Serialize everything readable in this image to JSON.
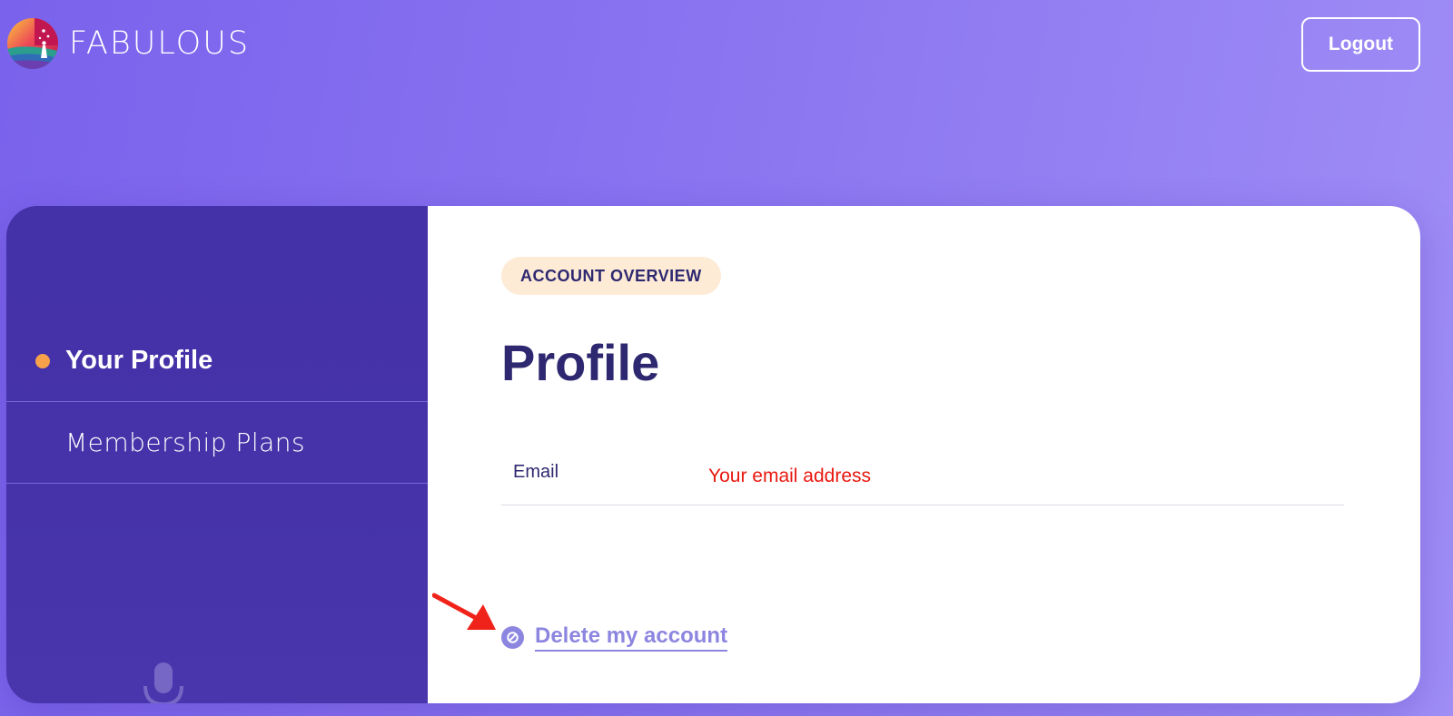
{
  "header": {
    "brand_name": "FABULOUS",
    "logout_label": "Logout"
  },
  "sidebar": {
    "items": [
      {
        "label": "Your Profile",
        "active": true
      },
      {
        "label": "Membership Plans",
        "active": false
      }
    ]
  },
  "main": {
    "badge": "ACCOUNT OVERVIEW",
    "title": "Profile",
    "fields": [
      {
        "label": "Email",
        "value": "Your email address"
      }
    ],
    "delete_label": "Delete my account"
  },
  "colors": {
    "background_start": "#7a62ec",
    "sidebar": "#4432a8",
    "active_dot": "#f7a24b",
    "heading": "#2e2870",
    "badge_bg": "#fdebd6",
    "error_text": "#e8190f",
    "link": "#8d86e0",
    "annotation": "#f0231a"
  }
}
